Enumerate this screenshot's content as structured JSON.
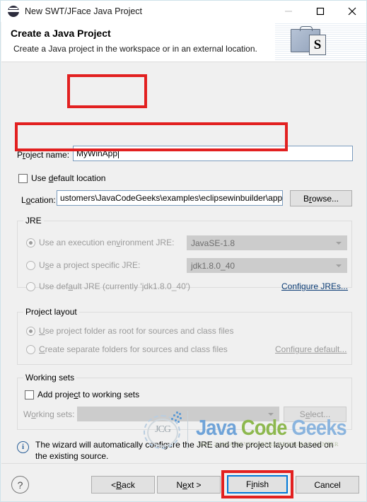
{
  "window": {
    "title": "New SWT/JFace Java Project",
    "icon": "eclipse-icon",
    "minimize_label": "—",
    "maximize_label": "□",
    "close_label": "✕"
  },
  "header": {
    "title": "Create a Java Project",
    "subtitle": "Create a Java project in the workspace or in an external location.",
    "badge_letter": "S"
  },
  "project_name": {
    "label_pre": "P",
    "label_key": "r",
    "label_post": "oject name:",
    "value": "MyWinApp"
  },
  "default_location": {
    "label_pre": "Use ",
    "label_key": "d",
    "label_post": "efault location",
    "checked": false
  },
  "location": {
    "label_pre": "L",
    "label_key": "o",
    "label_post": "cation:",
    "value": "ustomers\\JavaCodeGeeks\\examples\\eclipsewinbuilder\\app",
    "browse_pre": "B",
    "browse_key": "r",
    "browse_post": "owse..."
  },
  "jre": {
    "group_title": "JRE",
    "options": [
      {
        "label_pre": "Use an execution en",
        "label_key": "v",
        "label_post": "ironment JRE:",
        "selected": true,
        "combo_value": "JavaSE-1.8"
      },
      {
        "label_pre": "U",
        "label_key": "s",
        "label_post": "e a project specific JRE:",
        "selected": false,
        "combo_value": "jdk1.8.0_40"
      },
      {
        "label_pre": "Use def",
        "label_key": "a",
        "label_post": "ult JRE (currently 'jdk1.8.0_40')",
        "selected": false,
        "combo_value": ""
      }
    ],
    "configure_link": "Configure JREs..."
  },
  "project_layout": {
    "group_title": "Project layout",
    "options": [
      {
        "label_pre": "",
        "label_key": "U",
        "label_post": "se project folder as root for sources and class files",
        "selected": true
      },
      {
        "label_pre": "",
        "label_key": "C",
        "label_post": "reate separate folders for sources and class files",
        "selected": false
      }
    ],
    "configure_link": "Configure default..."
  },
  "working_sets": {
    "group_title": "Working sets",
    "add_checkbox_pre": "Add proje",
    "add_checkbox_key": "c",
    "add_checkbox_post": "t to working sets",
    "add_checked": false,
    "combo_label_pre": "W",
    "combo_label_key": "o",
    "combo_label_post": "rking sets:",
    "combo_value": "",
    "select_pre": "S",
    "select_key": "e",
    "select_post": "lect..."
  },
  "info": {
    "icon": "info-icon",
    "message": "The wizard will automatically configure the JRE and the project layout based on the existing source."
  },
  "logo": {
    "mark_text": "JCG",
    "word1": "Java",
    "word2": "Code",
    "word3": "Geeks",
    "tagline": "JAVA 2 JAVA DEVELOPERS RESOURCE CENTER"
  },
  "footer": {
    "help_label": "?",
    "back_pre": "< ",
    "back_key": "B",
    "back_post": "ack",
    "next_pre": "N",
    "next_key": "e",
    "next_post": "xt >",
    "finish_pre": "F",
    "finish_key": "i",
    "finish_post": "nish",
    "cancel": "Cancel"
  },
  "annotations": {
    "color": "#e22020",
    "boxes": [
      "project-name-highlight",
      "location-highlight",
      "finish-highlight"
    ]
  }
}
